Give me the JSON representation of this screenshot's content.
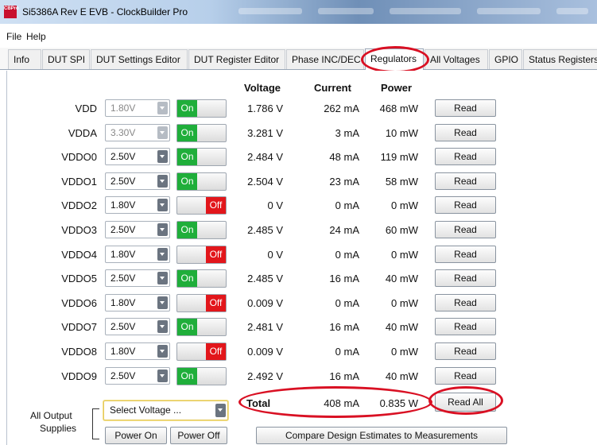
{
  "window": {
    "title": "Si5386A Rev E EVB - ClockBuilder Pro",
    "icon_text": "CBPro"
  },
  "menu": {
    "items": [
      "File",
      "Help"
    ]
  },
  "tabs": [
    "Info",
    "DUT SPI",
    "DUT Settings Editor",
    "DUT Register Editor",
    "Phase INC/DEC",
    "Regulators",
    "All Voltages",
    "GPIO",
    "Status Registers"
  ],
  "active_tab": "Regulators",
  "columns": {
    "voltage": "Voltage",
    "current": "Current",
    "power": "Power"
  },
  "rows": [
    {
      "name": "VDD",
      "setting": "1.80V",
      "enabled": false,
      "state": "On",
      "voltage": "1.786 V",
      "current": "262 mA",
      "power": "468 mW",
      "read": "Read"
    },
    {
      "name": "VDDA",
      "setting": "3.30V",
      "enabled": false,
      "state": "On",
      "voltage": "3.281 V",
      "current": "3 mA",
      "power": "10 mW",
      "read": "Read"
    },
    {
      "name": "VDDO0",
      "setting": "2.50V",
      "enabled": true,
      "state": "On",
      "voltage": "2.484 V",
      "current": "48 mA",
      "power": "119 mW",
      "read": "Read"
    },
    {
      "name": "VDDO1",
      "setting": "2.50V",
      "enabled": true,
      "state": "On",
      "voltage": "2.504 V",
      "current": "23 mA",
      "power": "58 mW",
      "read": "Read"
    },
    {
      "name": "VDDO2",
      "setting": "1.80V",
      "enabled": true,
      "state": "Off",
      "voltage": "0 V",
      "current": "0 mA",
      "power": "0 mW",
      "read": "Read"
    },
    {
      "name": "VDDO3",
      "setting": "2.50V",
      "enabled": true,
      "state": "On",
      "voltage": "2.485 V",
      "current": "24 mA",
      "power": "60 mW",
      "read": "Read"
    },
    {
      "name": "VDDO4",
      "setting": "1.80V",
      "enabled": true,
      "state": "Off",
      "voltage": "0 V",
      "current": "0 mA",
      "power": "0 mW",
      "read": "Read"
    },
    {
      "name": "VDDO5",
      "setting": "2.50V",
      "enabled": true,
      "state": "On",
      "voltage": "2.485 V",
      "current": "16 mA",
      "power": "40 mW",
      "read": "Read"
    },
    {
      "name": "VDDO6",
      "setting": "1.80V",
      "enabled": true,
      "state": "Off",
      "voltage": "0.009 V",
      "current": "0 mA",
      "power": "0 mW",
      "read": "Read"
    },
    {
      "name": "VDDO7",
      "setting": "2.50V",
      "enabled": true,
      "state": "On",
      "voltage": "2.481 V",
      "current": "16 mA",
      "power": "40 mW",
      "read": "Read"
    },
    {
      "name": "VDDO8",
      "setting": "1.80V",
      "enabled": true,
      "state": "Off",
      "voltage": "0.009 V",
      "current": "0 mA",
      "power": "0 mW",
      "read": "Read"
    },
    {
      "name": "VDDO9",
      "setting": "2.50V",
      "enabled": true,
      "state": "On",
      "voltage": "2.492 V",
      "current": "16 mA",
      "power": "40 mW",
      "read": "Read"
    }
  ],
  "total": {
    "label": "Total",
    "current": "408 mA",
    "power": "0.835 W",
    "read_all": "Read All"
  },
  "all_output": {
    "label_line1": "All Output",
    "label_line2": "Supplies",
    "select_placeholder": "Select Voltage ...",
    "power_on": "Power On",
    "power_off": "Power Off"
  },
  "compare_button": "Compare Design Estimates to Measurements",
  "colors": {
    "on": "#1fae3a",
    "off": "#e2161b",
    "annotation": "#d91023",
    "select_highlight": "#f2e08a"
  }
}
